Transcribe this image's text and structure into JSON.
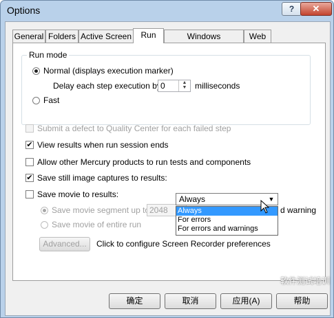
{
  "window": {
    "title": "Options",
    "help_glyph": "?",
    "close_glyph": "✕"
  },
  "tabs": [
    {
      "label": "General"
    },
    {
      "label": "Folders"
    },
    {
      "label": "Active Screen"
    },
    {
      "label": "Run"
    },
    {
      "label": "Windows Applications"
    },
    {
      "label": "Web"
    }
  ],
  "run_mode": {
    "title": "Run mode",
    "normal_label": "Normal (displays execution marker)",
    "delay_label": "Delay each step execution by:",
    "delay_value": "0",
    "delay_unit": "milliseconds",
    "fast_label": "Fast"
  },
  "options": {
    "submit_defect": "Submit a defect to Quality Center for each failed step",
    "view_results": "View results when run session ends",
    "allow_other": "Allow other Mercury products to run tests and components",
    "save_still": "Save still image captures to results:",
    "save_movie": "Save movie to results:",
    "segment_label": "Save movie segment up to",
    "segment_value": "2048",
    "segment_suffix": "d warning",
    "entire_run": "Save movie of entire run",
    "advanced_button": "Advanced...",
    "advanced_hint": "Click to configure Screen Recorder preferences"
  },
  "capture_combo": {
    "selected": "Always",
    "options": [
      "Always",
      "For errors",
      "For errors and warnings"
    ]
  },
  "buttons": {
    "ok": "确定",
    "cancel": "取消",
    "apply": "应用(A)",
    "help": "帮助"
  },
  "watermark": "软件测试培训",
  "check_glyph": "✔"
}
